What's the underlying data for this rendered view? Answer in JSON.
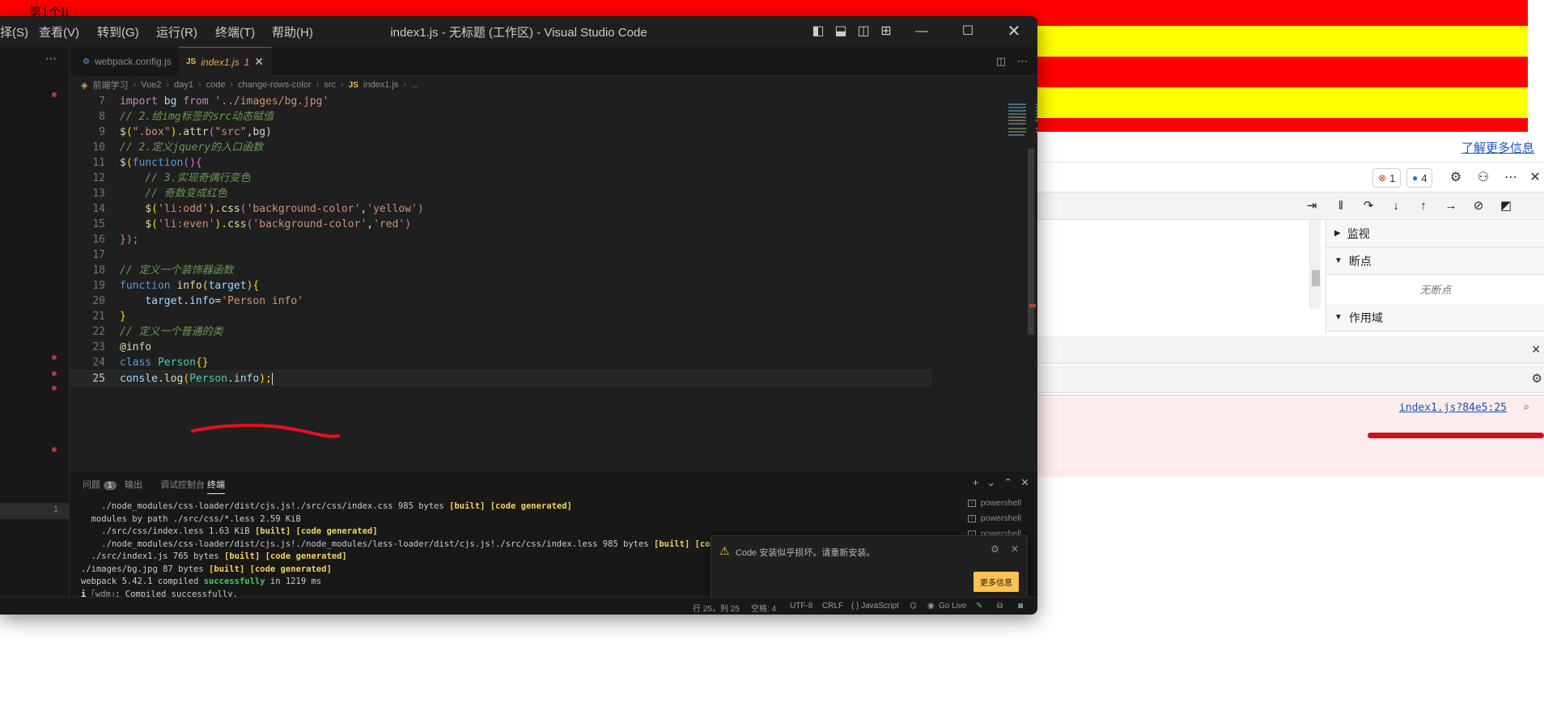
{
  "background_page": {
    "list_item_label": "第1个li",
    "stripes": [
      {
        "color": "#ff0000"
      },
      {
        "color": "#ffff00"
      },
      {
        "color": "#ff0000"
      },
      {
        "color": "#ffff00"
      },
      {
        "color": "#ff0000"
      }
    ],
    "learn_more": "了解更多信息"
  },
  "devtools": {
    "error_count": "1",
    "message_count": "4",
    "watch": "监视",
    "breakpoints": "断点",
    "no_breakpoints": "无断点",
    "scope": "作用域",
    "error_source_link": "index1.js?84e5:25",
    "colors": {
      "error_bg": "#fdecec",
      "annotation": "#d0101a"
    }
  },
  "vscode": {
    "menu": [
      "择(S)",
      "查看(V)",
      "转到(G)",
      "运行(R)",
      "终端(T)",
      "帮助(H)"
    ],
    "window_title": "index1.js - 无标题 (工作区) - Visual Studio Code",
    "tabs": [
      {
        "icon": "gear-icon",
        "label": "webpack.config.js",
        "active": false
      },
      {
        "icon": "JS",
        "label": "index1.js",
        "badge": "1",
        "active": true
      }
    ],
    "breadcrumb": [
      "前端学习",
      "Vue2",
      "day1",
      "code",
      "change-rows-color",
      "src",
      "index1.js",
      "..."
    ],
    "code_lines": [
      {
        "n": "7"
      },
      {
        "n": "8"
      },
      {
        "n": "9"
      },
      {
        "n": "10"
      },
      {
        "n": "11"
      },
      {
        "n": "12"
      },
      {
        "n": "13"
      },
      {
        "n": "14"
      },
      {
        "n": "15"
      },
      {
        "n": "16"
      },
      {
        "n": "17"
      },
      {
        "n": "18"
      },
      {
        "n": "19"
      },
      {
        "n": "20"
      },
      {
        "n": "21"
      },
      {
        "n": "22"
      },
      {
        "n": "23"
      },
      {
        "n": "24"
      },
      {
        "n": "25"
      }
    ],
    "code_text": {
      "l7_import": "import",
      "l7_bg": " bg ",
      "l7_from": "from",
      "l7_path": " '../images/bg.jpg'",
      "l8": "// 2.给img标签的src动态赋值",
      "l9_a": "$",
      "l9_b": "(",
      "l9_c": "\".box\"",
      "l9_d": ").",
      "l9_e": "attr",
      "l9_f": "(",
      "l9_g": "\"src\"",
      "l9_h": ",bg)",
      "l10": "// 2.定义jquery的入口函数",
      "l11_a": "$",
      "l11_b": "(",
      "l11_c": "function",
      "l11_d": "(){",
      "l12": "    // 3.实现奇偶行变色",
      "l13": "    // 奇数变成红色",
      "l14_a": "    $",
      "l14_b": "(",
      "l14_c": "'li:odd'",
      "l14_d": ").",
      "l14_e": "css",
      "l14_f": "(",
      "l14_g": "'background-color'",
      "l14_h": ",",
      "l14_i": "'yellow'",
      "l14_j": ")",
      "l15_a": "    $",
      "l15_b": "(",
      "l15_c": "'li:even'",
      "l15_d": ").",
      "l15_e": "css",
      "l15_f": "(",
      "l15_g": "'background-color'",
      "l15_h": ",",
      "l15_i": "'red'",
      "l15_j": ")",
      "l16": "});",
      "l18": "// 定义一个装饰器函数",
      "l19_a": "function",
      "l19_b": " info",
      "l19_c": "(",
      "l19_d": "target",
      "l19_e": "){",
      "l20_a": "    target",
      "l20_b": ".",
      "l20_c": "info",
      "l20_d": "=",
      "l20_e": "'Person info'",
      "l21": "}",
      "l22": "// 定义一个普通的类",
      "l23": "@info",
      "l24_a": "class",
      "l24_b": " Person",
      "l24_c": "{}",
      "l25_a": "consle",
      "l25_b": ".",
      "l25_c": "log",
      "l25_d": "(",
      "l25_e": "Person",
      "l25_f": ".",
      "l25_g": "info",
      "l25_h": ");"
    },
    "panel_tabs": {
      "problems": "问题",
      "problems_count": "1",
      "output": "输出",
      "debug_console": "调试控制台",
      "terminal": "终端"
    },
    "terminal": {
      "t1_a": "    ./node_modules/css-loader/dist/cjs.js!./src/css/index.css 985 bytes ",
      "t1_b": "[built] [code generated]",
      "t2": "  modules by path ./src/css/*.less 2.59 KiB",
      "t3_a": "    ./src/css/index.less 1.63 KiB ",
      "t3_b": "[built] [code generated]",
      "t4_a": "    ./node_modules/css-loader/dist/cjs.js!./node_modules/less-loader/dist/cjs.js!./src/css/index.less 985 bytes ",
      "t4_b": "[built] [code generated]",
      "t5_a": "  ./src/index1.js 765 bytes ",
      "t5_b": "[built] [code generated]",
      "t6_a": "./images/bg.jpg 87 bytes ",
      "t6_b": "[built] [code generated]",
      "t7_a": "webpack 5.42.1 compiled ",
      "t7_b": "successfully",
      "t7_c": " in 1219 ms",
      "t8_a": "i ",
      "t8_b": "｢wdm｣",
      "t8_c": ": Compiled successfully."
    },
    "shells": [
      "powershell",
      "powershell",
      "powershell"
    ],
    "notification": {
      "text": "Code 安装似乎损坏。请重新安装。",
      "button": "更多信息"
    },
    "statusbar": {
      "position": "行 25，列 25",
      "spaces": "空格: 4",
      "encoding": "UTF-8",
      "eol": "CRLF",
      "language": "{ } JavaScript",
      "golive": "Go Live"
    }
  }
}
